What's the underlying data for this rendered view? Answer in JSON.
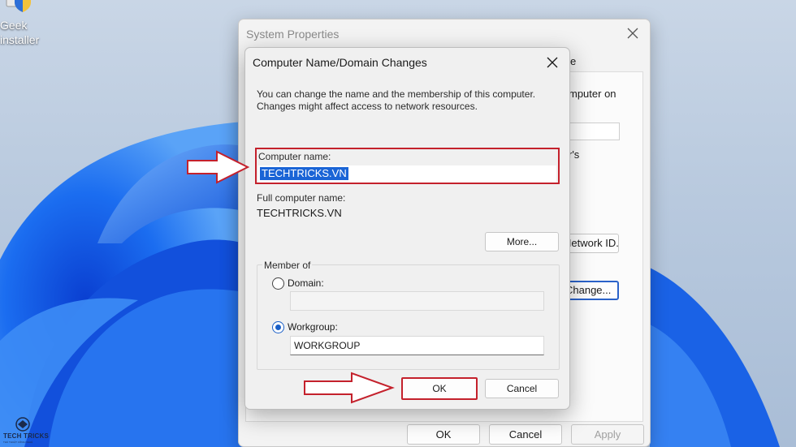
{
  "desktop": {
    "icon_label_line1": "Geek",
    "icon_label_line2": "installer"
  },
  "watermark": {
    "brand": "TECH TRICKS",
    "tagline": "THỦ THUẬT CÔNG NGHỆ"
  },
  "system_properties": {
    "title": "System Properties",
    "tab_fragment": "e",
    "text_fragment1": "mputer on",
    "text_fragment2": "r's",
    "network_id_button": "Network ID...",
    "change_button": "Change...",
    "footer": {
      "ok": "OK",
      "cancel": "Cancel",
      "apply": "Apply"
    }
  },
  "dialog": {
    "title": "Computer Name/Domain Changes",
    "description": "You can change the name and the membership of this computer. Changes might affect access to network resources.",
    "computer_name_label": "Computer name:",
    "computer_name_value": "TECHTRICKS.VN",
    "full_name_label": "Full computer name:",
    "full_name_value": "TECHTRICKS.VN",
    "more_button": "More...",
    "member_of": {
      "legend": "Member of",
      "domain_label": "Domain:",
      "domain_value": "",
      "workgroup_label": "Workgroup:",
      "workgroup_value": "WORKGROUP",
      "selected": "workgroup"
    },
    "ok_button": "OK",
    "cancel_button": "Cancel"
  },
  "colors": {
    "highlight_red": "#c4212c",
    "accent_blue": "#1a5fc7",
    "selection_blue": "#1a64d6"
  }
}
